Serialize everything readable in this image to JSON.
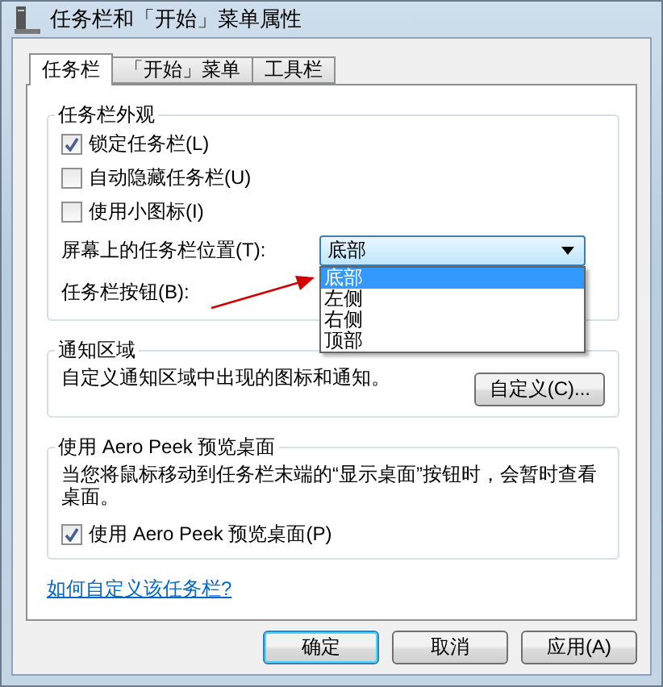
{
  "window": {
    "title": "任务栏和「开始」菜单属性"
  },
  "tabs": [
    {
      "label": "任务栏",
      "selected": true
    },
    {
      "label": "「开始」菜单",
      "selected": false
    },
    {
      "label": "工具栏",
      "selected": false
    }
  ],
  "appearance": {
    "title": "任务栏外观",
    "checkboxes": [
      {
        "label": "锁定任务栏(L)",
        "checked": true
      },
      {
        "label": "自动隐藏任务栏(U)",
        "checked": false
      },
      {
        "label": "使用小图标(I)",
        "checked": false
      }
    ],
    "position": {
      "label": "屏幕上的任务栏位置(T):",
      "value": "底部",
      "expanded": true,
      "options": [
        {
          "label": "底部",
          "selected": true
        },
        {
          "label": "左侧",
          "selected": false
        },
        {
          "label": "右侧",
          "selected": false
        },
        {
          "label": "顶部",
          "selected": false
        }
      ]
    },
    "buttons_label": "任务栏按钮(B):"
  },
  "notification": {
    "title": "通知区域",
    "text": "自定义通知区域中出现的图标和通知。",
    "button": "自定义(C)..."
  },
  "aero_peek": {
    "title": "使用 Aero Peek 预览桌面",
    "text": "当您将鼠标移动到任务栏末端的“显示桌面”按钮时，会暂时查看桌面。",
    "checkbox": {
      "label": "使用 Aero Peek 预览桌面(P)",
      "checked": true
    }
  },
  "help_link": "如何自定义该任务栏?",
  "buttons": [
    {
      "label": "确定",
      "default": true
    },
    {
      "label": "取消",
      "default": false
    },
    {
      "label": "应用(A)",
      "default": false
    }
  ]
}
